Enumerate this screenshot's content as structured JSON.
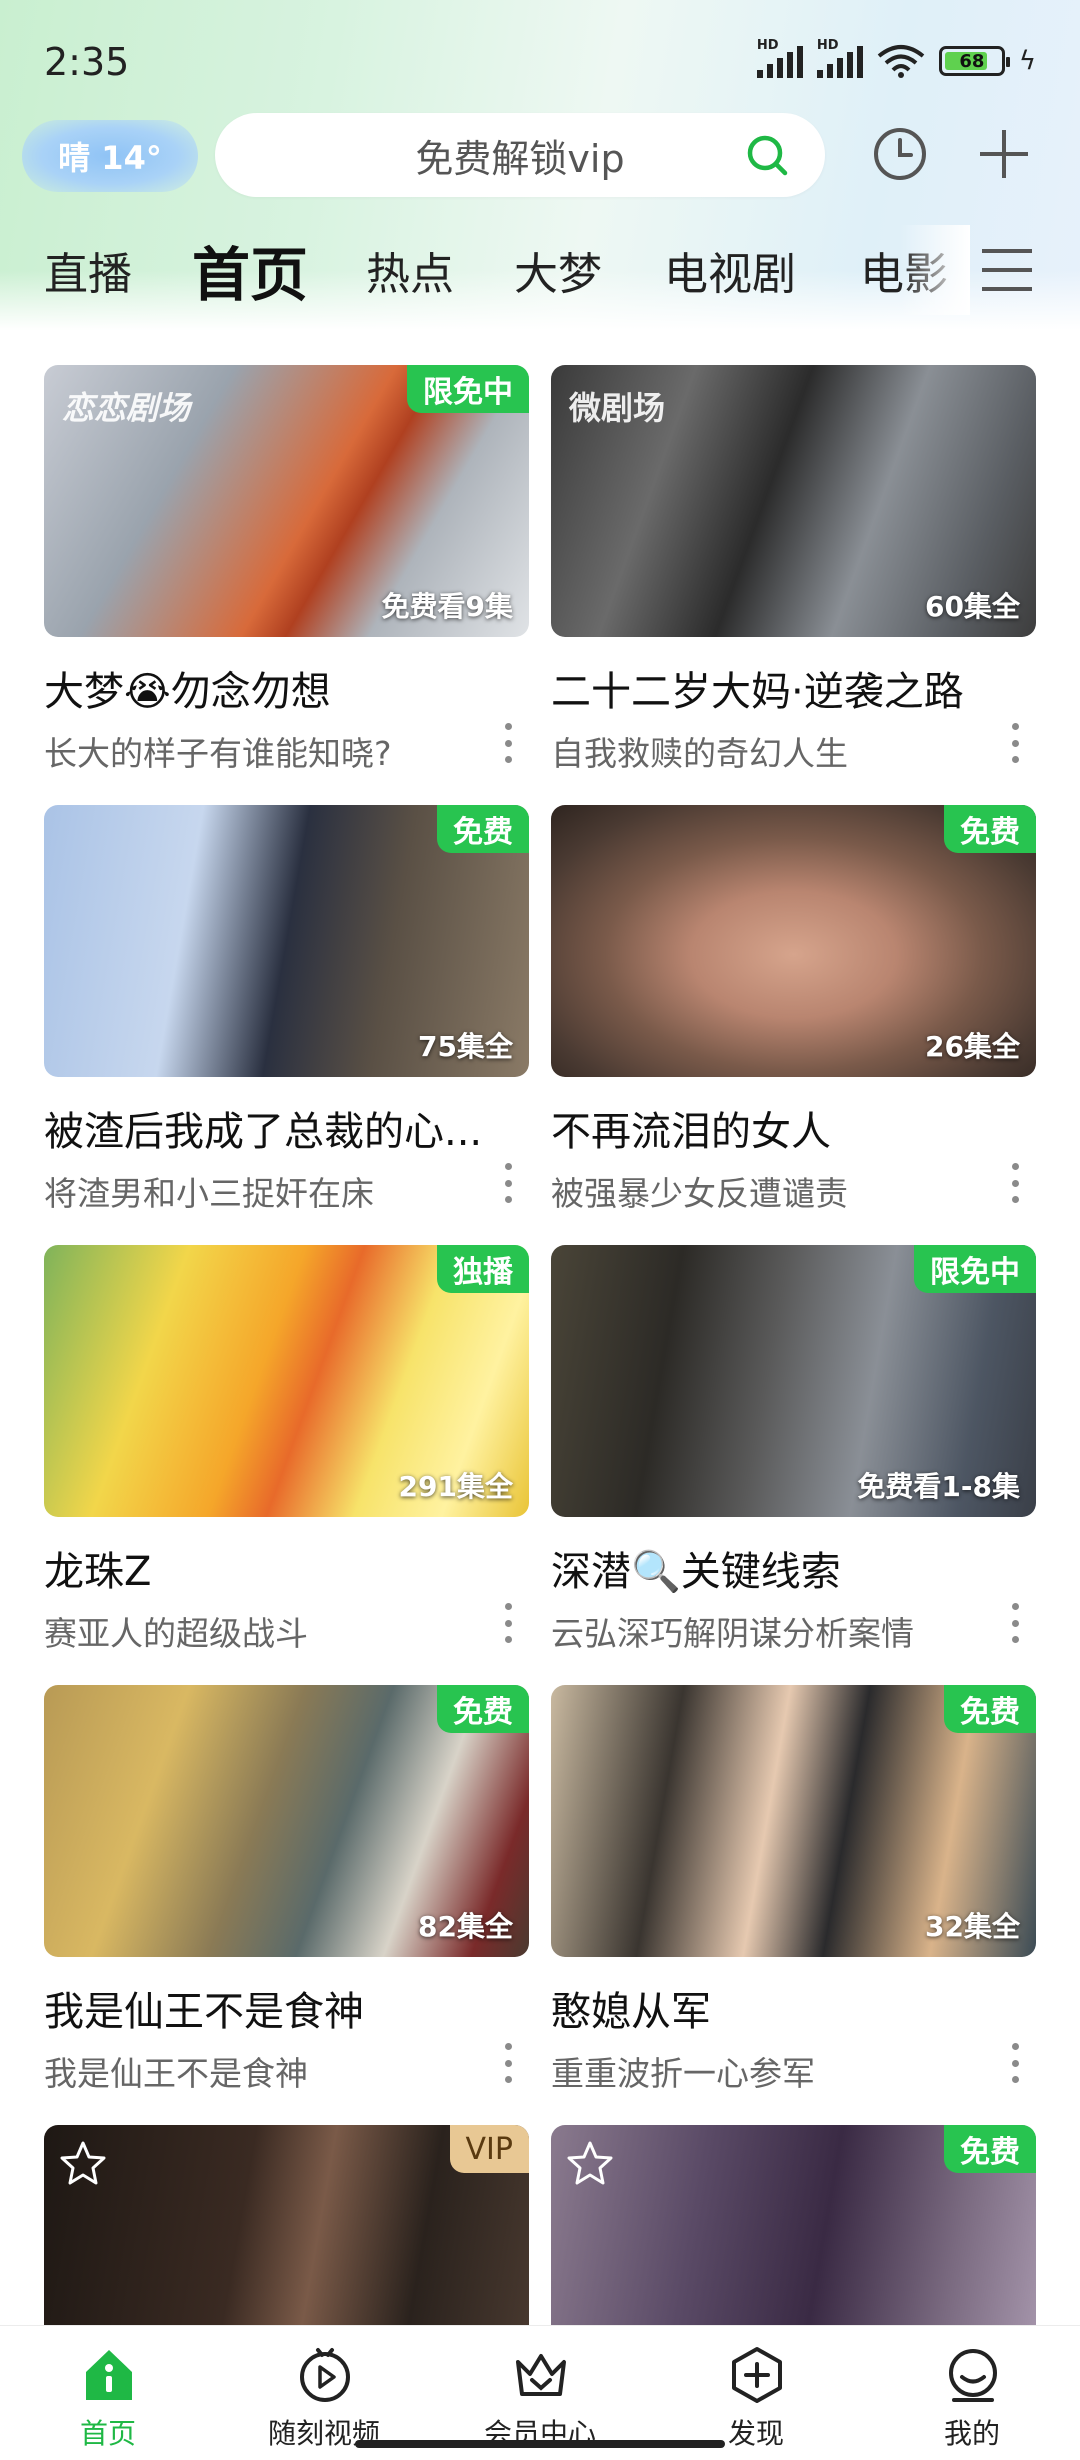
{
  "status_bar": {
    "time": "2:35",
    "battery": "68",
    "hd1": "HD",
    "hd2": "HD"
  },
  "header": {
    "weather": "晴 14°",
    "search_placeholder": "免费解锁vip"
  },
  "tabs": [
    {
      "label": "直播",
      "active": false
    },
    {
      "label": "首页",
      "active": true
    },
    {
      "label": "热点",
      "active": false
    },
    {
      "label": "大梦",
      "active": false
    },
    {
      "label": "电视剧",
      "active": false
    },
    {
      "label": "电影",
      "active": false
    }
  ],
  "cards": [
    {
      "title": "大梦😭勿念勿想",
      "subtitle": "长大的样子有谁能知晓?",
      "badge": "限免中",
      "episodes": "免费看9集",
      "watermark": "恋恋剧场"
    },
    {
      "title": "二十二岁大妈·逆袭之路",
      "subtitle": "自我救赎的奇幻人生",
      "badge": "",
      "episodes": "60集全",
      "watermark": "微剧场"
    },
    {
      "title": "被渣后我成了总裁的心...",
      "subtitle": "将渣男和小三捉奸在床",
      "badge": "免费",
      "episodes": "75集全"
    },
    {
      "title": "不再流泪的女人",
      "subtitle": "被强暴少女反遭谴责",
      "badge": "免费",
      "episodes": "26集全"
    },
    {
      "title": "龙珠Z",
      "subtitle": "赛亚人的超级战斗",
      "badge": "独播",
      "episodes": "291集全"
    },
    {
      "title": "深潜🔍关键线索",
      "subtitle": "云弘深巧解阴谋分析案情",
      "badge": "限免中",
      "episodes": "免费看1-8集"
    },
    {
      "title": "我是仙王不是食神",
      "subtitle": "我是仙王不是食神",
      "badge": "免费",
      "episodes": "82集全"
    },
    {
      "title": "憨媳从军",
      "subtitle": "重重波折一心参军",
      "badge": "免费",
      "episodes": "32集全"
    },
    {
      "badge": "VIP"
    },
    {
      "badge": "免费"
    }
  ],
  "bottom_nav": [
    {
      "label": "首页",
      "icon": "home-icon",
      "active": true
    },
    {
      "label": "随刻视频",
      "icon": "play-circle-icon",
      "active": false
    },
    {
      "label": "会员中心",
      "icon": "crown-icon",
      "active": false
    },
    {
      "label": "发现",
      "icon": "discover-plus-icon",
      "active": false
    },
    {
      "label": "我的",
      "icon": "profile-icon",
      "active": false
    }
  ],
  "colors": {
    "accent": "#1fb845",
    "badge_green": "#28c450",
    "badge_vip": "#e8c894"
  }
}
